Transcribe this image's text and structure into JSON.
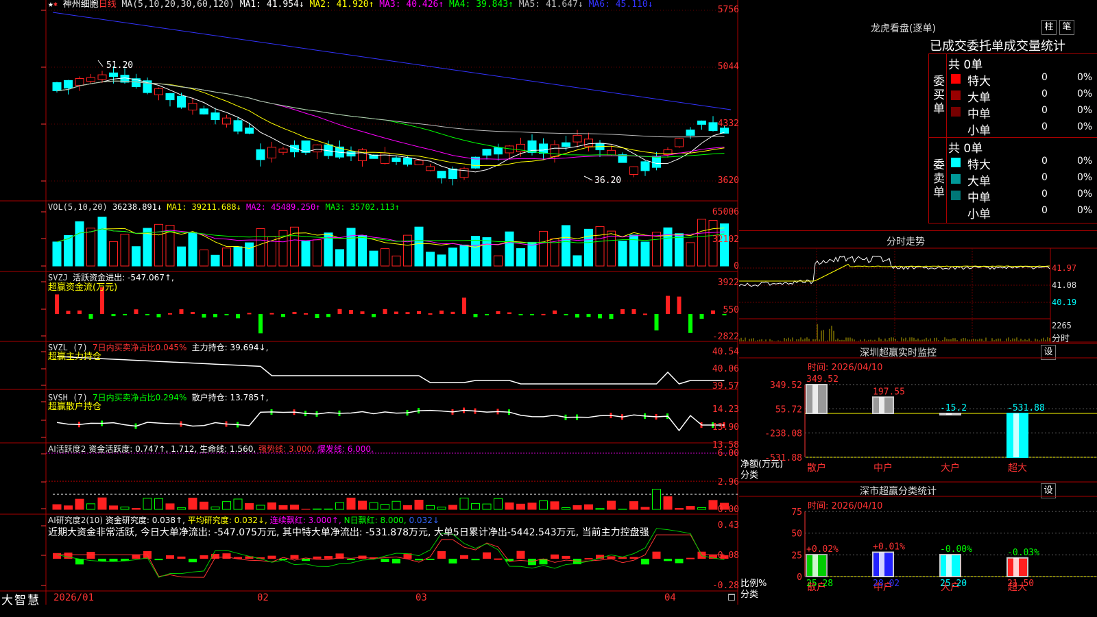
{
  "app": {
    "logo": "大智慧"
  },
  "stock": {
    "name": "神州细胞",
    "period": "日线"
  },
  "colors": {
    "up": "#ff2020",
    "down": "#00ffff",
    "bg": "#000000",
    "grid": "#aa0000"
  },
  "main_chart": {
    "ma_label": "MA(5,10,20,30,60,120)",
    "ma_values": [
      {
        "k": "MA1:",
        "v": "41.954↓",
        "c": "#ffffff"
      },
      {
        "k": "MA2:",
        "v": "41.920↑",
        "c": "#ffff00"
      },
      {
        "k": "MA3:",
        "v": "40.426↑",
        "c": "#ff00ff"
      },
      {
        "k": "MA4:",
        "v": "39.843↑",
        "c": "#00ff00"
      },
      {
        "k": "MA5:",
        "v": "41.647↓",
        "c": "#bbbbbb"
      },
      {
        "k": "MA6:",
        "v": "45.110↓",
        "c": "#3333ff"
      }
    ],
    "y_ticks": [
      "5756",
      "5044",
      "4332",
      "3620"
    ],
    "high_label": "51.20",
    "low_label": "36.20"
  },
  "vol_panel": {
    "label": "VOL(5,10,20)",
    "value": "36238.891↓",
    "mas": [
      {
        "k": "MA1:",
        "v": "39211.688↓",
        "c": "#ffff00"
      },
      {
        "k": "MA2:",
        "v": "45489.250↑",
        "c": "#ff00ff"
      },
      {
        "k": "MA3:",
        "v": "35702.113↑",
        "c": "#00ff00"
      }
    ],
    "y_ticks": [
      "65006",
      "32102",
      "0"
    ]
  },
  "svzj_panel": {
    "label": "SVZJ",
    "text": "活跃资金进出: -547.067↑,",
    "sub": "超赢资金流(万元)",
    "y_ticks": [
      "3922",
      "550",
      "-2822"
    ]
  },
  "svzl_panel": {
    "label": "SVZL (7)",
    "ratio": "7日内买卖净占比0.045%",
    "text": "主力持仓: 39.694↓,",
    "sub": "超赢主力持仓",
    "y_ticks": [
      "40.54",
      "40.06",
      "39.57"
    ]
  },
  "svsh_panel": {
    "label": "SVSH (7)",
    "ratio": "7日内买卖净占比0.294%",
    "text": "散户持仓: 13.785↑,",
    "sub": "超赢散户持仓",
    "y_ticks": [
      "14.23",
      "13.90",
      "13.58"
    ]
  },
  "ai_active_panel": {
    "label": "AI活跃度2",
    "text1": "资金活跃度: 0.747↑, 1.712,",
    "text2": "生命线: 1.560,",
    "text3": "强势线: 3.000,",
    "text4": "爆发线: 6.000,",
    "y_ticks": [
      "6.00",
      "2.96",
      "0.00"
    ]
  },
  "ai_research_panel": {
    "label": "AI研究度2(10)",
    "text1": "资金研究度: 0.038↑,",
    "text2": "平均研究度: 0.032↓,",
    "text3": "连续飘红: 3.000↑,",
    "text4": "N日飘红: 8.000,",
    "text5": "0.032↓",
    "summary": "近期大资金非常活跃, 今日大单净流出: -547.075万元, 其中特大单净流出: -531.878万元, 大单5日累计净出-5442.543万元, 当前主力控盘强",
    "y_ticks": [
      "0.43",
      "0.08",
      "-0.28"
    ]
  },
  "x_axis": [
    "2026/01",
    "02",
    "03",
    "04"
  ],
  "lhp": {
    "title": "龙虎看盘(逐单)",
    "btn1": "柱",
    "btn2": "笔",
    "subtitle": "已成交委托单成交量统计",
    "buy_label": "委买单",
    "sell_label": "委卖单",
    "buy_total": "共 0单",
    "sell_total": "共 0单",
    "buy_rows": [
      {
        "name": "特大",
        "count": "0",
        "pct": "0%",
        "color": "#ff0000"
      },
      {
        "name": "大单",
        "count": "0",
        "pct": "0%",
        "color": "#990000"
      },
      {
        "name": "中单",
        "count": "0",
        "pct": "0%",
        "color": "#770000"
      },
      {
        "name": "小单",
        "count": "0",
        "pct": "0%",
        "color": "#000000"
      }
    ],
    "sell_rows": [
      {
        "name": "特大",
        "count": "0",
        "pct": "0%",
        "color": "#00ffff"
      },
      {
        "name": "大单",
        "count": "0",
        "pct": "0%",
        "color": "#009999"
      },
      {
        "name": "中单",
        "count": "0",
        "pct": "0%",
        "color": "#007777"
      },
      {
        "name": "小单",
        "count": "0",
        "pct": "0%",
        "color": "#000000"
      }
    ]
  },
  "intraday": {
    "title": "分时走势",
    "y_ticks": [
      "41.97",
      "41.08",
      "40.19"
    ],
    "vol_tick": "2265",
    "vol_label": "分时"
  },
  "sz_monitor": {
    "title": "深圳超赢实时监控",
    "btn": "设",
    "time": "时间: 2026/04/10",
    "y_ticks": [
      "349.52",
      "55.72",
      "-238.08",
      "-531.88"
    ],
    "ylabel_1": "净额(万元)",
    "ylabel_2": "分类",
    "categories": [
      "散户",
      "中户",
      "大户",
      "超大"
    ],
    "values": [
      349.52,
      197.55,
      -15.2,
      -531.88
    ],
    "value_labels": [
      "349.52",
      "197.55",
      "-15.2",
      "-531.88"
    ],
    "ylim": [
      -531.88,
      349.52
    ]
  },
  "sz_class": {
    "title": "深市超赢分类统计",
    "btn": "设",
    "time": "时间: 2026/04/10",
    "y_ticks": [
      "75",
      "50",
      "25",
      "0"
    ],
    "ylabel_1": "比例%",
    "ylabel_2": "分类",
    "categories": [
      "散户",
      "中户",
      "大户",
      "超大"
    ],
    "values": [
      25.28,
      28.02,
      25.2,
      21.5
    ],
    "value_labels": [
      "25.28",
      "28.02",
      "25.20",
      "21.50"
    ],
    "change_labels": [
      "+0.02%",
      "+0.01%",
      "-0.00%",
      "-0.03%"
    ],
    "ylim": [
      0,
      75
    ]
  }
}
